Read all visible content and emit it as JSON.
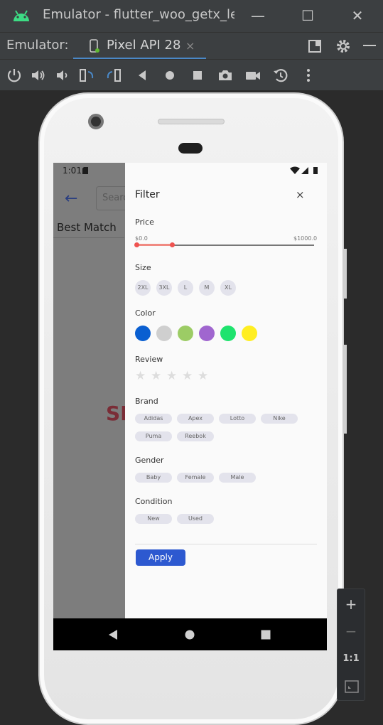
{
  "window": {
    "title": "Emulator - flutter_woo_getx_le",
    "minimize": "—",
    "maximize": "☐",
    "close": "✕"
  },
  "tabbar": {
    "label": "Emulator:",
    "tab_name": "Pixel API 28",
    "tab_close": "×"
  },
  "app": {
    "status_time": "1:01",
    "search_placeholder": "Search",
    "best_match": "Best Match",
    "brand_text": "SH"
  },
  "filter": {
    "title": "Filter",
    "close": "×",
    "price": {
      "label": "Price",
      "min_label": "$0.0",
      "max_label": "$1000.0",
      "range": [
        0,
        200
      ],
      "max": 1000
    },
    "size": {
      "label": "Size",
      "options": [
        "2XL",
        "3XL",
        "L",
        "M",
        "XL"
      ]
    },
    "color": {
      "label": "Color",
      "options": [
        "#0a5fd1",
        "#cfcfcf",
        "#9ccc65",
        "#a066cf",
        "#1ee36e",
        "#ffee22"
      ]
    },
    "review": {
      "label": "Review",
      "stars": 5,
      "rating": 0
    },
    "brand": {
      "label": "Brand",
      "options": [
        "Adidas",
        "Apex",
        "Lotto",
        "Nike",
        "Puma",
        "Reebok"
      ]
    },
    "gender": {
      "label": "Gender",
      "options": [
        "Baby",
        "Female",
        "Male"
      ]
    },
    "condition": {
      "label": "Condition",
      "options": [
        "New",
        "Used"
      ]
    },
    "apply_label": "Apply"
  },
  "zoom_controls": {
    "zoom_in": "+",
    "zoom_out": "−",
    "actual_size": "1:1"
  }
}
